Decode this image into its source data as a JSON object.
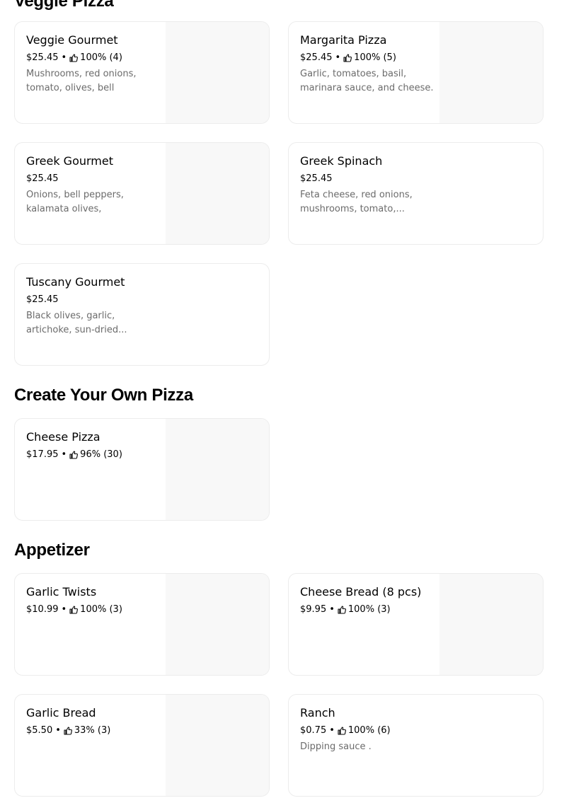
{
  "sections": {
    "veggie": {
      "title": "Veggie Pizza"
    },
    "create": {
      "title": "Create Your Own Pizza"
    },
    "appetizer": {
      "title": "Appetizer"
    }
  },
  "items": {
    "veggie_gourmet": {
      "name": "Veggie Gourmet",
      "price": "$25.45",
      "rating": "100% (4)",
      "desc1": "Mushrooms, red onions,",
      "desc2": "tomato, olives, bell pepper..."
    },
    "margarita": {
      "name": "Margarita Pizza",
      "price": "$25.45",
      "rating": "100% (5)",
      "desc1": "Garlic, tomatoes, basil,",
      "desc2": "marinara sauce, and cheese."
    },
    "greek_gourmet": {
      "name": "Greek Gourmet",
      "price": "$25.45",
      "desc1": "Onions, bell peppers,",
      "desc2": "kalamata olives, tomatoes,..."
    },
    "greek_spinach": {
      "name": "Greek Spinach",
      "price": "$25.45",
      "desc1": "Feta cheese, red onions,",
      "desc2": "mushrooms, tomato,..."
    },
    "tuscany": {
      "name": "Tuscany Gourmet",
      "price": "$25.45",
      "desc1": "Black olives, garlic,",
      "desc2": "artichoke, sun-dried..."
    },
    "cheese_pizza": {
      "name": "Cheese Pizza",
      "price": "$17.95",
      "rating": "96% (30)"
    },
    "garlic_twists": {
      "name": "Garlic Twists",
      "price": "$10.99",
      "rating": "100% (3)"
    },
    "cheese_bread": {
      "name": "Cheese Bread (8 pcs)",
      "price": "$9.95",
      "rating": "100% (3)"
    },
    "garlic_bread": {
      "name": "Garlic Bread",
      "price": "$5.50",
      "rating": "33% (3)"
    },
    "ranch": {
      "name": "Ranch",
      "price": "$0.75",
      "rating": "100% (6)",
      "desc1": "Dipping sauce ."
    }
  },
  "meta": {
    "separator": "•",
    "rating_icon": "thumbs-up-icon"
  },
  "colors": {
    "card_border": "#ececec",
    "image_placeholder": "#f8f8f8",
    "description": "#6b6b6b"
  }
}
